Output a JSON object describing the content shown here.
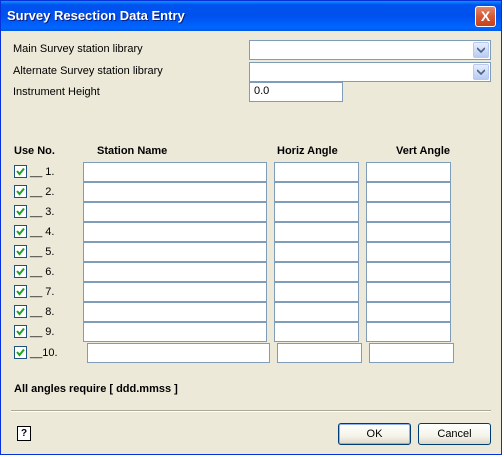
{
  "window": {
    "title": "Survey Resection Data Entry",
    "close_label": "X"
  },
  "form": {
    "main_library_label": "Main Survey station library",
    "main_library_value": "",
    "alt_library_label": "Alternate  Survey station library",
    "alt_library_value": "",
    "instrument_height_label": "Instrument Height",
    "instrument_height_value": "0.0"
  },
  "table": {
    "headers": {
      "use_no": "Use No.",
      "station_name": "Station Name",
      "horiz_angle": "Horiz Angle",
      "vert_angle": "Vert  Angle"
    },
    "rows": [
      {
        "num": "__ 1.",
        "checked": true,
        "station": "",
        "horiz": "",
        "vert": ""
      },
      {
        "num": "__ 2.",
        "checked": true,
        "station": "",
        "horiz": "",
        "vert": ""
      },
      {
        "num": "__ 3.",
        "checked": true,
        "station": "",
        "horiz": "",
        "vert": ""
      },
      {
        "num": "__ 4.",
        "checked": true,
        "station": "",
        "horiz": "",
        "vert": ""
      },
      {
        "num": "__ 5.",
        "checked": true,
        "station": "",
        "horiz": "",
        "vert": ""
      },
      {
        "num": "__ 6.",
        "checked": true,
        "station": "",
        "horiz": "",
        "vert": ""
      },
      {
        "num": "__ 7.",
        "checked": true,
        "station": "",
        "horiz": "",
        "vert": ""
      },
      {
        "num": "__ 8.",
        "checked": true,
        "station": "",
        "horiz": "",
        "vert": ""
      },
      {
        "num": "__ 9.",
        "checked": true,
        "station": "",
        "horiz": "",
        "vert": ""
      },
      {
        "num": "__10.",
        "checked": true,
        "station": "",
        "horiz": "",
        "vert": ""
      }
    ]
  },
  "note": "All angles require [ ddd.mmss ]",
  "buttons": {
    "ok": "OK",
    "cancel": "Cancel",
    "help_icon": "help-question-icon",
    "help_glyph": "?"
  },
  "colors": {
    "titlebar": "#0054e3",
    "dialog_bg": "#ece9d8",
    "check": "#21a121"
  }
}
